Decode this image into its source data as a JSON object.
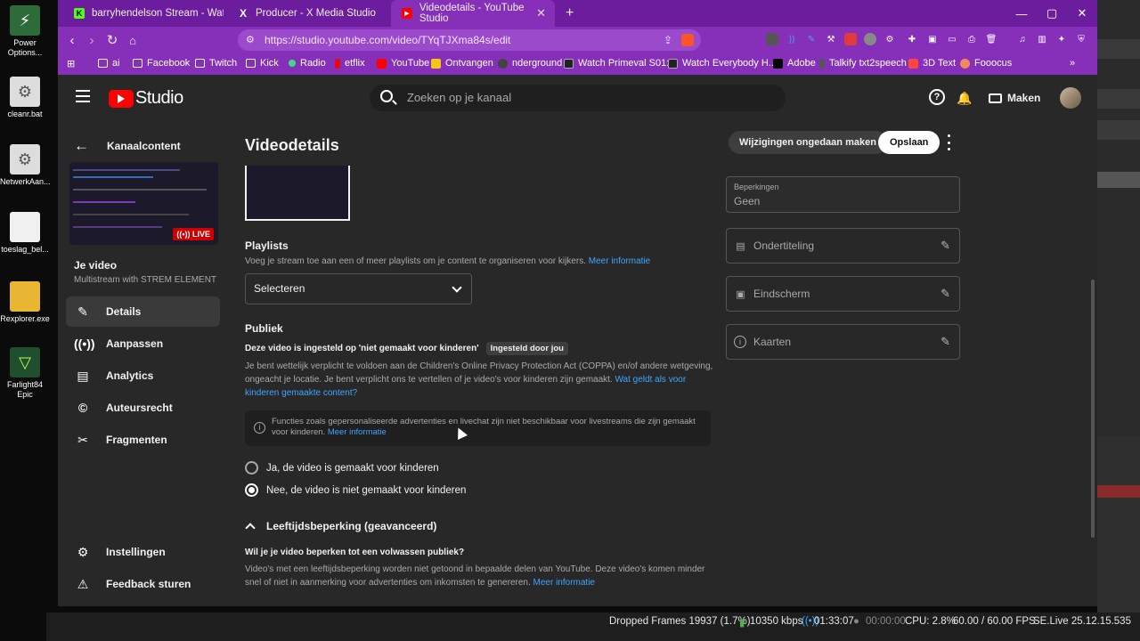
{
  "desktop": {
    "icons": [
      {
        "label": "Power Options...",
        "color": "#2d6b3a"
      },
      {
        "label": "cleanr.bat",
        "color": "#dddddd"
      },
      {
        "label": "NetwerkAan...",
        "color": "#dddddd"
      },
      {
        "label": "toeslag_bel...",
        "color": "#f0f0f0"
      },
      {
        "label": "Rexplorer.exe",
        "color": "#e9b634"
      },
      {
        "label": "Farlight84 Epic",
        "color": "#1f4f2f"
      }
    ]
  },
  "browser": {
    "tabs": [
      {
        "label": "barryhendelson Stream - Watch Live",
        "icon": "kick-icon",
        "color": "#53fc18"
      },
      {
        "label": "Producer - X Media Studio",
        "icon": "x-icon",
        "color": "#000000"
      },
      {
        "label": "Videodetails - YouTube Studio",
        "icon": "youtube-icon",
        "color": "#ff0000"
      }
    ],
    "new_tab": "+",
    "window_controls": {
      "minimize": "—",
      "maximize": "▢",
      "close": "✕"
    },
    "url": "https://studio.youtube.com/video/TYqTJXma84s/edit",
    "bookmarks": [
      "ai",
      "Facebook",
      "Twitch",
      "Kick",
      "Radio",
      "etflix",
      "YouTube",
      "Ontvangen",
      "nderground",
      "Watch Primeval S01:...",
      "Watch Everybody H...",
      "Adobe",
      "Talkify txt2speech",
      "3D Text",
      "Fooocus"
    ],
    "more": "»"
  },
  "studio": {
    "logo_text": "Studio",
    "search_placeholder": "Zoeken op je kanaal",
    "create_label": "Maken",
    "sidebar": {
      "back_label": "Kanaalcontent",
      "live_badge": "LIVE",
      "your_video": "Je video",
      "video_title": "Multistream with STREM ELEMENTS...",
      "items": [
        {
          "label": "Details",
          "icon": "pencil-icon"
        },
        {
          "label": "Aanpassen",
          "icon": "broadcast-icon"
        },
        {
          "label": "Analytics",
          "icon": "chart-icon"
        },
        {
          "label": "Auteursrecht",
          "icon": "copyright-icon"
        },
        {
          "label": "Fragmenten",
          "icon": "scissors-icon"
        }
      ],
      "bottom_items": [
        {
          "label": "Instellingen",
          "icon": "gear-icon"
        },
        {
          "label": "Feedback sturen",
          "icon": "feedback-icon"
        }
      ]
    },
    "main": {
      "title": "Videodetails",
      "undo_label": "Wijzigingen ongedaan maken",
      "save_label": "Opslaan",
      "playlists": {
        "heading": "Playlists",
        "desc": "Voeg je stream toe aan een of meer playlists om je content te organiseren voor kijkers.",
        "link": "Meer informatie",
        "select_label": "Selecteren"
      },
      "audience": {
        "heading": "Publiek",
        "kids_status": "Deze video is ingesteld op 'niet gemaakt voor kinderen'",
        "badge": "Ingesteld door jou",
        "desc": "Je bent wettelijk verplicht te voldoen aan de Children's Online Privacy Protection Act (COPPA) en/of andere wetgeving, ongeacht je locatie. Je bent verplicht ons te vertellen of je video's voor kinderen zijn gemaakt.",
        "link": "Wat geldt als voor kinderen gemaakte content?",
        "notice": "Functies zoals gepersonaliseerde advertenties en livechat zijn niet beschikbaar voor livestreams die zijn gemaakt voor kinderen.",
        "notice_link": "Meer informatie",
        "option_yes": "Ja, de video is gemaakt voor kinderen",
        "option_no": "Nee, de video is niet gemaakt voor kinderen"
      },
      "age": {
        "toggle_label": "Leeftijdsbeperking (geavanceerd)",
        "question": "Wil je je video beperken tot een volwassen publiek?",
        "desc": "Video's met een leeftijdsbeperking worden niet getoond in bepaalde delen van YouTube. Deze video's komen minder snel of niet in aanmerking voor advertenties om inkomsten te genereren.",
        "link": "Meer informatie"
      },
      "right": {
        "restrictions_label": "Beperkingen",
        "restrictions_value": "Geen",
        "subtitles": "Ondertiteling",
        "endscreen": "Eindscherm",
        "cards": "Kaarten"
      }
    }
  },
  "status": {
    "dropped": "Dropped Frames 19937 (1.7%)",
    "bitrate": "10350 kbps",
    "stream_time": "01:33:07",
    "rec_time": "00:00:00",
    "cpu": "CPU: 2.8%",
    "fps": "60.00 / 60.00 FPS",
    "version": "SE.Live 25.12.15.535"
  }
}
